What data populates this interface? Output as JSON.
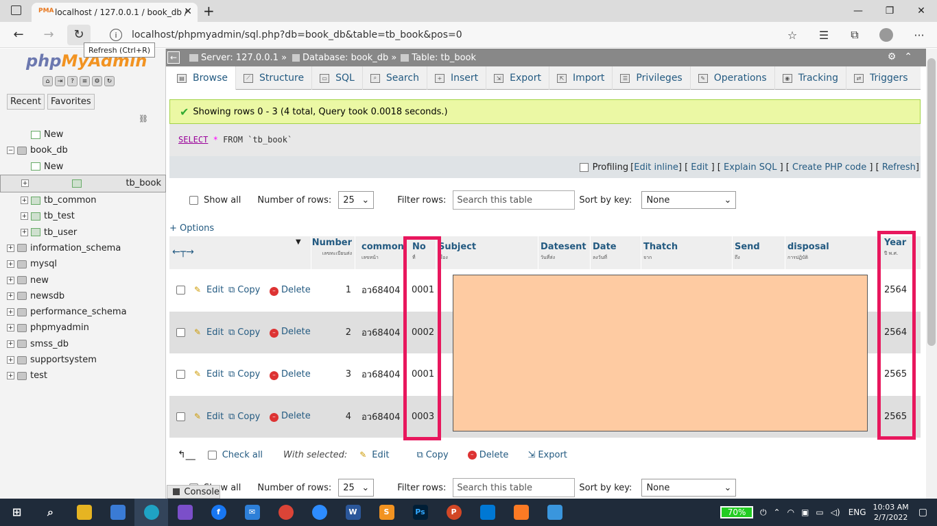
{
  "browser": {
    "tab_title": "localhost / 127.0.0.1 / book_db /",
    "url": "localhost/phpmyadmin/sql.php?db=book_db&table=tb_book&pos=0",
    "tooltip": "Refresh (Ctrl+R)"
  },
  "sidebar": {
    "logo_a": "php",
    "logo_b": "MyAdmin",
    "tabs": [
      "Recent",
      "Favorites"
    ],
    "tree": [
      {
        "label": "New",
        "level": 1,
        "kind": "new"
      },
      {
        "label": "book_db",
        "level": 0,
        "kind": "db",
        "expanded": true
      },
      {
        "label": "New",
        "level": 2,
        "kind": "new"
      },
      {
        "label": "tb_book",
        "level": 2,
        "kind": "table",
        "selected": true
      },
      {
        "label": "tb_common",
        "level": 2,
        "kind": "table"
      },
      {
        "label": "tb_test",
        "level": 2,
        "kind": "table"
      },
      {
        "label": "tb_user",
        "level": 2,
        "kind": "table"
      },
      {
        "label": "information_schema",
        "level": 0,
        "kind": "db"
      },
      {
        "label": "mysql",
        "level": 0,
        "kind": "db"
      },
      {
        "label": "new",
        "level": 0,
        "kind": "db"
      },
      {
        "label": "newsdb",
        "level": 0,
        "kind": "db"
      },
      {
        "label": "performance_schema",
        "level": 0,
        "kind": "db"
      },
      {
        "label": "phpmyadmin",
        "level": 0,
        "kind": "db"
      },
      {
        "label": "smss_db",
        "level": 0,
        "kind": "db"
      },
      {
        "label": "supportsystem",
        "level": 0,
        "kind": "db"
      },
      {
        "label": "test",
        "level": 0,
        "kind": "db"
      }
    ]
  },
  "breadcrumb": {
    "server": "Server: 127.0.0.1 »",
    "database": "Database: book_db »",
    "table": "Table: tb_book"
  },
  "menu": [
    "Browse",
    "Structure",
    "SQL",
    "Search",
    "Insert",
    "Export",
    "Import",
    "Privileges",
    "Operations",
    "Tracking",
    "Triggers"
  ],
  "success_message": "Showing rows 0 - 3 (4 total, Query took 0.0018 seconds.)",
  "sql": {
    "kw": "SELECT",
    "op": "*",
    "from": "FROM",
    "table": "`tb_book`"
  },
  "profiling": {
    "label": "Profiling",
    "links": [
      "Edit inline",
      "Edit",
      "Explain SQL",
      "Create PHP code",
      "Refresh"
    ]
  },
  "nav": {
    "show_all": "Show all",
    "num_rows_label": "Number of rows:",
    "num_rows": "25",
    "filter_label": "Filter rows:",
    "filter_placeholder": "Search this table",
    "sort_label": "Sort by key:",
    "sort_value": "None"
  },
  "options_link": "+ Options",
  "columns": [
    {
      "name": "Number",
      "sub": "เลขทะเบียนส่ง"
    },
    {
      "name": "common",
      "sub": "เลขหน้า"
    },
    {
      "name": "No",
      "sub": "ที่"
    },
    {
      "name": "Subject",
      "sub": "เรื่อง"
    },
    {
      "name": "Datesent",
      "sub": "วันที่ส่ง"
    },
    {
      "name": "Date",
      "sub": "ลงวันที่"
    },
    {
      "name": "Thatch",
      "sub": "จาก"
    },
    {
      "name": "Send",
      "sub": "ถึง"
    },
    {
      "name": "disposal",
      "sub": "การปฏิบัติ"
    },
    {
      "name": "Year",
      "sub": "ปี พ.ศ."
    }
  ],
  "row_actions": {
    "edit": "Edit",
    "copy": "Copy",
    "delete": "Delete"
  },
  "rows": [
    {
      "number": "1",
      "common": "อว68404",
      "no": "0001",
      "year": "2564"
    },
    {
      "number": "2",
      "common": "อว68404",
      "no": "0002",
      "year": "2564"
    },
    {
      "number": "3",
      "common": "อว68404",
      "no": "0001",
      "year": "2565"
    },
    {
      "number": "4",
      "common": "อว68404",
      "no": "0003",
      "year": "2565"
    }
  ],
  "bottom": {
    "check_all": "Check all",
    "with_selected": "With selected:",
    "edit": "Edit",
    "copy": "Copy",
    "delete": "Delete",
    "export": "Export"
  },
  "console_label": "Console",
  "taskbar": {
    "battery": "70%",
    "lang": "ENG",
    "time": "10:03 AM",
    "date": "2/7/2022"
  }
}
